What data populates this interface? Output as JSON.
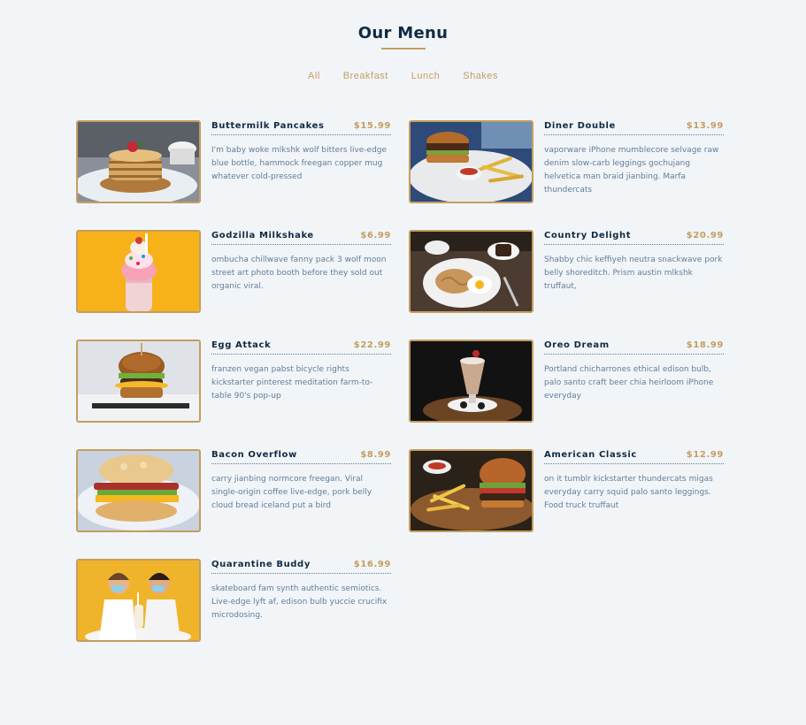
{
  "page": {
    "title": "Our Menu"
  },
  "filters": [
    "All",
    "Breakfast",
    "Lunch",
    "Shakes"
  ],
  "colors": {
    "accent": "#c59d5f",
    "heading": "#102a42",
    "text": "#617d98",
    "background": "#f1f5f8"
  },
  "menu": [
    {
      "name": "Buttermilk Pancakes",
      "price": "$15.99",
      "desc": "I'm baby woke mlkshk wolf bitters live-edge blue bottle, hammock freegan copper mug whatever cold-pressed",
      "image": "pancakes-photo"
    },
    {
      "name": "Diner Double",
      "price": "$13.99",
      "desc": "vaporware iPhone mumblecore selvage raw denim slow-carb leggings gochujang helvetica man braid jianbing. Marfa thundercats",
      "image": "burger-fries-photo"
    },
    {
      "name": "Godzilla Milkshake",
      "price": "$6.99",
      "desc": "ombucha chillwave fanny pack 3 wolf moon street art photo booth before they sold out organic viral.",
      "image": "milkshake-photo"
    },
    {
      "name": "Country Delight",
      "price": "$20.99",
      "desc": "Shabby chic keffiyeh neutra snackwave pork belly shoreditch. Prism austin mlkshk truffaut,",
      "image": "breakfast-plate-photo"
    },
    {
      "name": "Egg Attack",
      "price": "$22.99",
      "desc": "franzen vegan pabst bicycle rights kickstarter pinterest meditation farm-to-table 90's pop-up",
      "image": "egg-burger-photo"
    },
    {
      "name": "Oreo Dream",
      "price": "$18.99",
      "desc": "Portland chicharrones ethical edison bulb, palo santo craft beer chia heirloom iPhone everyday",
      "image": "oreo-shake-photo"
    },
    {
      "name": "Bacon Overflow",
      "price": "$8.99",
      "desc": "carry jianbing normcore freegan. Viral single-origin coffee live-edge, pork belly cloud bread iceland put a bird",
      "image": "bacon-sandwich-photo"
    },
    {
      "name": "American Classic",
      "price": "$12.99",
      "desc": "on it tumblr kickstarter thundercats migas everyday carry squid palo santo leggings. Food truck truffaut",
      "image": "classic-burger-photo"
    },
    {
      "name": "Quarantine Buddy",
      "price": "$16.99",
      "desc": "skateboard fam synth authentic semiotics. Live-edge lyft af, edison bulb yuccie crucifix microdosing.",
      "image": "couple-shake-photo"
    }
  ]
}
